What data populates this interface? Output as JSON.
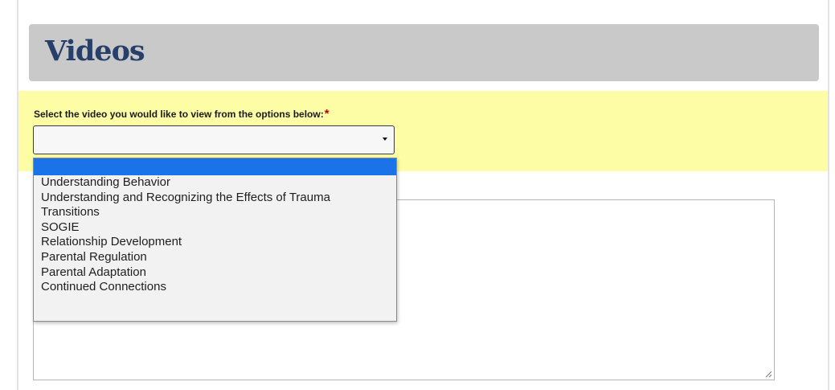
{
  "section": {
    "title": "Videos"
  },
  "question": {
    "label": "Select the video you would like to view from the options below:",
    "required_marker": "*"
  },
  "video_select": {
    "selected_value": "",
    "options": [
      "",
      "Understanding Behavior",
      "Understanding and Recognizing the Effects of Trauma",
      "Transitions",
      "SOGIE",
      "Relationship Development",
      "Parental Regulation",
      "Parental Adaptation",
      "Continued Connections"
    ],
    "highlighted_index": 0,
    "expanded": true
  },
  "icons": {
    "dropdown_arrow": "chevron-down-icon",
    "resize": "resize-grip-icon"
  },
  "colors": {
    "header_background": "#c9c9c9",
    "header_text": "#26406b",
    "question_band": "#fdfda6",
    "required": "#c00000",
    "highlight": "#1a73e8"
  }
}
